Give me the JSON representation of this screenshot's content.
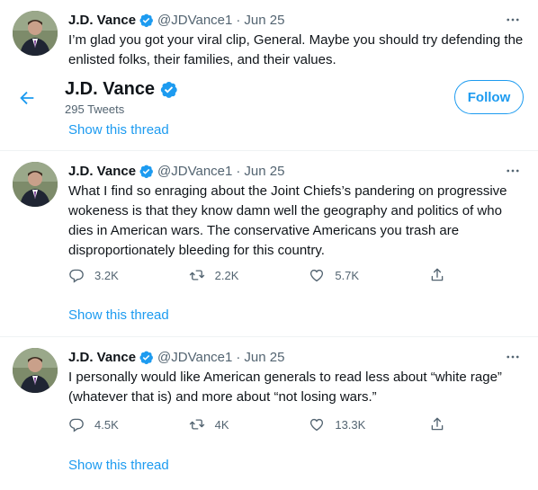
{
  "colors": {
    "accent": "#1d9bf0",
    "text": "#0f1419",
    "secondary": "#536471",
    "divider": "#eff3f4"
  },
  "header": {
    "name": "J.D. Vance",
    "tweets_count": "295 Tweets",
    "follow_label": "Follow"
  },
  "tweets": [
    {
      "name": "J.D. Vance",
      "handle": "@JDVance1",
      "dot": "·",
      "date": "Jun 25",
      "text": "I’m glad you got your viral clip, General. Maybe you should try defending the enlisted folks, their families, and their values.",
      "show_thread": "Show this thread"
    },
    {
      "name": "J.D. Vance",
      "handle": "@JDVance1",
      "dot": "·",
      "date": "Jun 25",
      "text": "What I find so enraging about the Joint Chiefs’s pandering on progressive wokeness is that they know damn well the geography and politics of who dies in American wars. The conservative Americans you trash are disproportionately bleeding for this country.",
      "replies": "3.2K",
      "retweets": "2.2K",
      "likes": "5.7K",
      "show_thread": "Show this thread"
    },
    {
      "name": "J.D. Vance",
      "handle": "@JDVance1",
      "dot": "·",
      "date": "Jun 25",
      "text": "I personally would like American generals to read less about “white rage” (whatever that is) and more about “not losing wars.”",
      "replies": "4.5K",
      "retweets": "4K",
      "likes": "13.3K",
      "show_thread": "Show this thread"
    }
  ],
  "icons": [
    "verified-badge-icon",
    "more-icon",
    "back-arrow-icon",
    "reply-icon",
    "retweet-icon",
    "like-icon",
    "share-icon"
  ]
}
